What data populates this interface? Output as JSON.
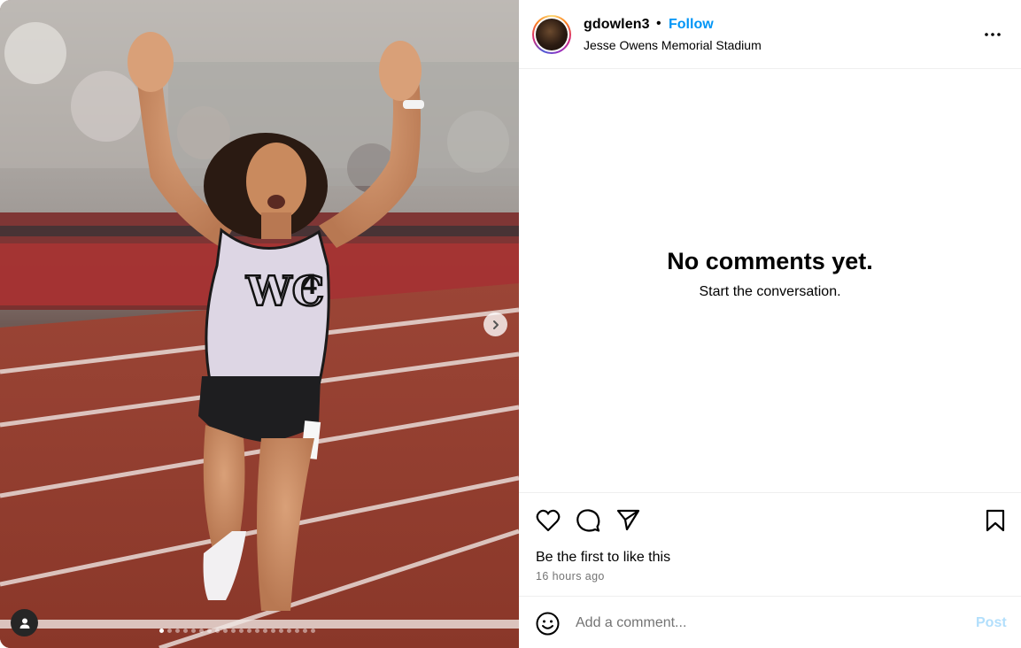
{
  "post": {
    "username": "gdowlen3",
    "separator": "•",
    "follow_label": "Follow",
    "location": "Jesse Owens Memorial Stadium"
  },
  "media": {
    "carousel_count": 20,
    "active_index": 0,
    "jersey_text": "WC",
    "bib_number": "4"
  },
  "comments": {
    "empty_title": "No comments yet.",
    "empty_subtitle": "Start the conversation."
  },
  "engagement": {
    "likes_text": "Be the first to like this",
    "timestamp": "16 hours ago"
  },
  "composer": {
    "placeholder": "Add a comment...",
    "post_label": "Post"
  },
  "icons": {
    "like": "heart-icon",
    "comment": "comment-bubble-icon",
    "share": "paper-plane-icon",
    "save": "bookmark-icon",
    "more": "more-dots-icon",
    "emoji": "emoji-icon",
    "next": "chevron-right-icon",
    "tags": "user-tag-icon"
  },
  "colors": {
    "accent": "#0095f6",
    "post_disabled": "#b2dffc",
    "muted": "#737373",
    "track": "#8c3a30"
  }
}
